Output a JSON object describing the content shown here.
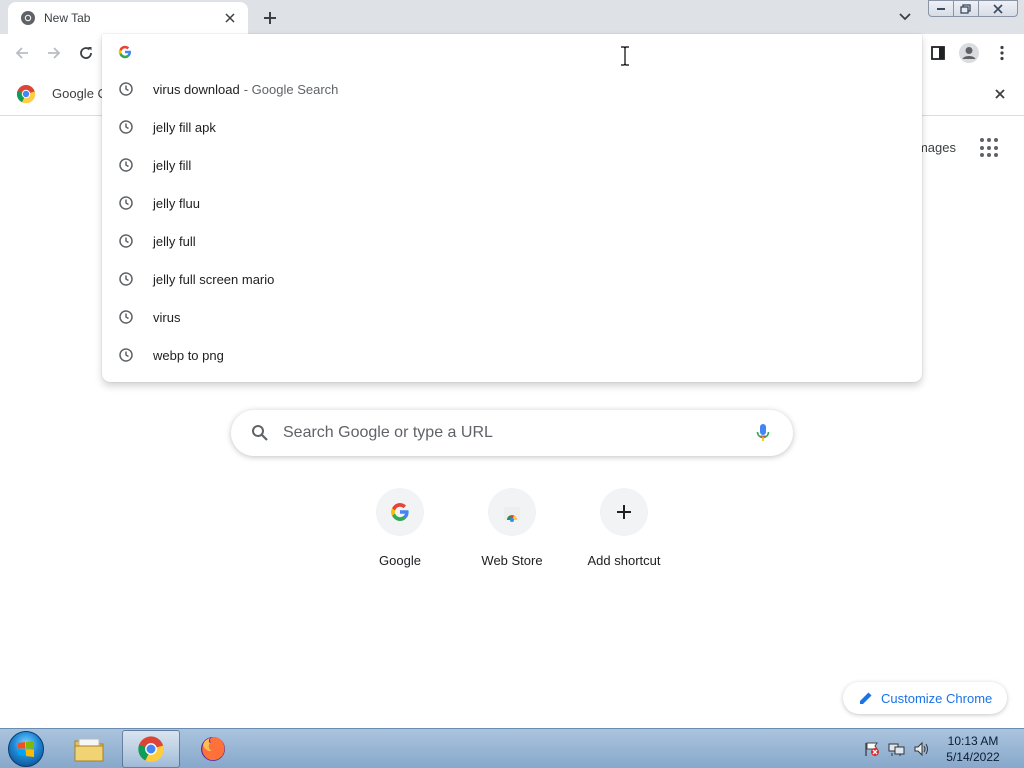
{
  "browser": {
    "tab": {
      "title": "New Tab"
    },
    "infobar": {
      "text": "Google C"
    }
  },
  "omnibox": {
    "value": "",
    "suggestions": [
      {
        "text": "virus download",
        "suffix": "- Google Search"
      },
      {
        "text": "jelly fill apk",
        "suffix": ""
      },
      {
        "text": "jelly fill",
        "suffix": ""
      },
      {
        "text": "jelly fluu",
        "suffix": ""
      },
      {
        "text": "jelly full",
        "suffix": ""
      },
      {
        "text": "jelly full screen mario",
        "suffix": ""
      },
      {
        "text": "virus",
        "suffix": ""
      },
      {
        "text": "webp to png",
        "suffix": ""
      }
    ]
  },
  "ntp": {
    "images_label": "Images",
    "search_placeholder": "Search Google or type a URL",
    "shortcuts": [
      {
        "label": "Google",
        "icon": "google-g-icon"
      },
      {
        "label": "Web Store",
        "icon": "web-store-icon"
      },
      {
        "label": "Add shortcut",
        "icon": "plus-icon"
      }
    ],
    "customize_label": "Customize Chrome"
  },
  "taskbar": {
    "apps": [
      "file-explorer",
      "chrome",
      "firefox"
    ],
    "clock": {
      "time": "10:13 AM",
      "date": "5/14/2022"
    }
  },
  "colors": {
    "accent": "#1a73e8",
    "tabstrip": "#dee1e6",
    "icon_gray": "#5f6368"
  }
}
